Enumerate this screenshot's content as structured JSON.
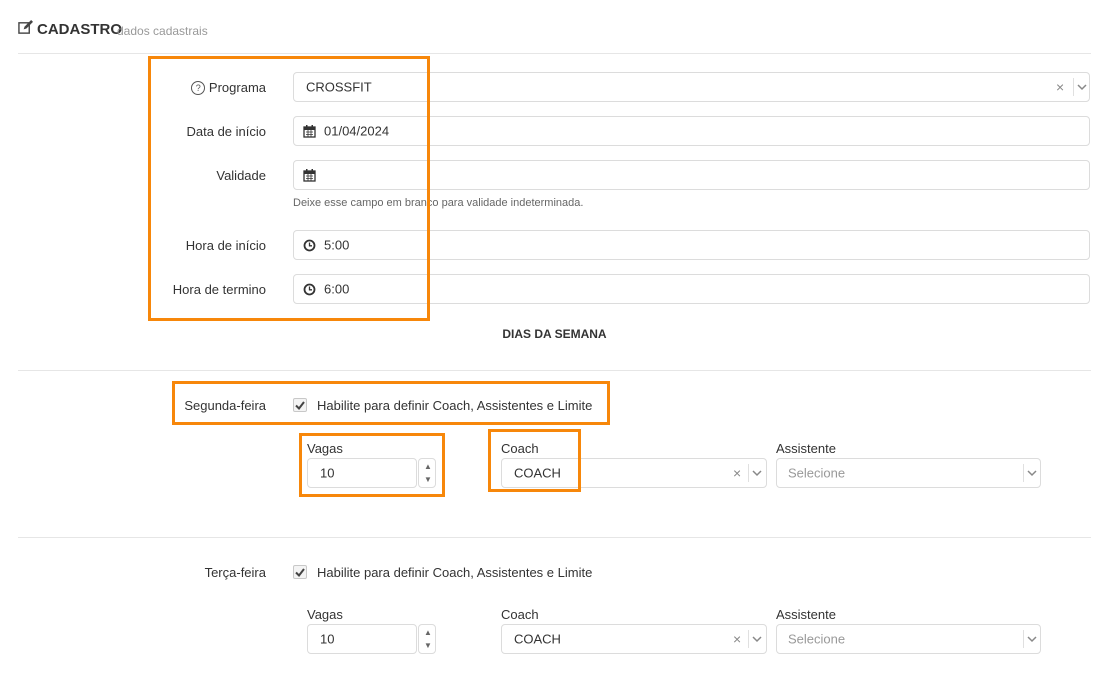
{
  "header": {
    "title": "CADASTRO",
    "subtitle": "dados cadastrais",
    "icon": "edit-icon"
  },
  "form": {
    "programa": {
      "label": "Programa",
      "value": "CROSSFIT"
    },
    "data_inicio": {
      "label": "Data de início",
      "value": "01/04/2024"
    },
    "validade": {
      "label": "Validade",
      "value": "",
      "help": "Deixe esse campo em branco para validade indeterminada."
    },
    "hora_inicio": {
      "label": "Hora de início",
      "value": "5:00"
    },
    "hora_termino": {
      "label": "Hora de termino",
      "value": "6:00"
    }
  },
  "dias_section_title": "DIAS DA SEMANA",
  "days": [
    {
      "label": "Segunda-feira",
      "checkbox_label": "Habilite para definir Coach, Assistentes e Limite",
      "checked": true,
      "vagas_label": "Vagas",
      "vagas_value": "10",
      "coach_label": "Coach",
      "coach_value": "COACH",
      "assistente_label": "Assistente",
      "assistente_placeholder": "Selecione"
    },
    {
      "label": "Terça-feira",
      "checkbox_label": "Habilite para definir Coach, Assistentes e Limite",
      "checked": true,
      "vagas_label": "Vagas",
      "vagas_value": "10",
      "coach_label": "Coach",
      "coach_value": "COACH",
      "assistente_label": "Assistente",
      "assistente_placeholder": "Selecione"
    }
  ],
  "colors": {
    "highlight": "#f7870a",
    "border": "#dcdcdc"
  }
}
